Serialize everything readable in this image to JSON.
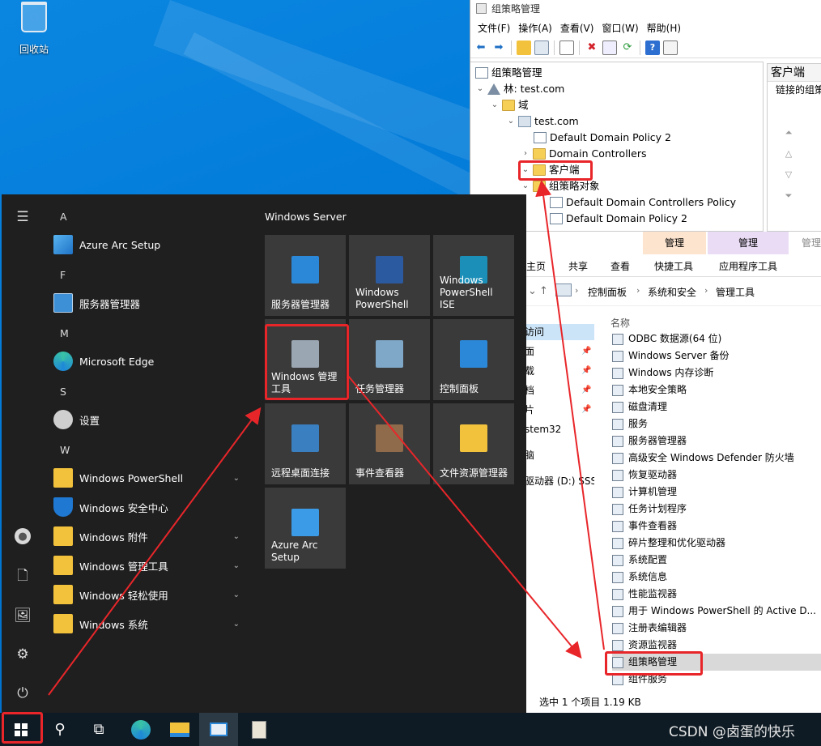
{
  "desktop": {
    "recycle_bin_label": "回收站"
  },
  "gpmc": {
    "title": "组策略管理",
    "menu": [
      "文件(F)",
      "操作(A)",
      "查看(V)",
      "窗口(W)",
      "帮助(H)"
    ],
    "tree": {
      "root": "组策略管理",
      "forest": "林: test.com",
      "domains": "域",
      "domain": "test.com",
      "gpo_link": "Default Domain Policy 2",
      "ou_dc": "Domain Controllers",
      "ou_client": "客户端",
      "gpo_container": "组策略对象",
      "gpo_items": [
        "Default Domain Controllers Policy",
        "Default Domain Policy 2"
      ]
    },
    "right_pane": {
      "header": "客户端",
      "subtitle": "链接的组策"
    }
  },
  "explorer": {
    "context_tabs": [
      "管理",
      "管理",
      "管理"
    ],
    "ribbon_tabs": [
      "主页",
      "共享",
      "查看",
      "快捷工具",
      "应用程序工具"
    ],
    "breadcrumb": [
      "控制面板",
      "系统和安全",
      "管理工具"
    ],
    "column_header": "名称",
    "nav_items": [
      "访问",
      "面",
      "载",
      "档",
      "片",
      "stem32",
      "脑",
      "驱动器 (D:) SSS"
    ],
    "files": [
      "ODBC 数据源(64 位)",
      "Windows Server 备份",
      "Windows 内存诊断",
      "本地安全策略",
      "磁盘清理",
      "服务",
      "服务器管理器",
      "高级安全 Windows Defender 防火墙",
      "恢复驱动器",
      "计算机管理",
      "任务计划程序",
      "事件查看器",
      "碎片整理和优化驱动器",
      "系统配置",
      "系统信息",
      "性能监视器",
      "用于 Windows PowerShell 的 Active D...",
      "注册表编辑器",
      "资源监视器",
      "组策略管理",
      "组件服务"
    ],
    "selected_file": "组策略管理",
    "status": "选中 1 个项目  1.19 KB"
  },
  "start_menu": {
    "sections": [
      {
        "letter": "A",
        "items": [
          {
            "label": "Azure Arc Setup",
            "icon": "azure-arc-icon"
          }
        ]
      },
      {
        "letter": "F",
        "items": [
          {
            "label": "服务器管理器",
            "icon": "server-manager-icon"
          }
        ]
      },
      {
        "letter": "M",
        "items": [
          {
            "label": "Microsoft Edge",
            "icon": "edge-icon"
          }
        ]
      },
      {
        "letter": "S",
        "items": [
          {
            "label": "设置",
            "icon": "gear-icon"
          }
        ]
      },
      {
        "letter": "W",
        "items": [
          {
            "label": "Windows PowerShell",
            "icon": "folder-icon",
            "expandable": true
          },
          {
            "label": "Windows 安全中心",
            "icon": "shield-icon",
            "expandable": false
          },
          {
            "label": "Windows 附件",
            "icon": "folder-icon",
            "expandable": true
          },
          {
            "label": "Windows 管理工具",
            "icon": "folder-icon",
            "expandable": true
          },
          {
            "label": "Windows 轻松使用",
            "icon": "folder-icon",
            "expandable": true
          },
          {
            "label": "Windows 系统",
            "icon": "folder-icon",
            "expandable": true
          }
        ]
      }
    ],
    "tiles_title": "Windows Server",
    "tiles": [
      {
        "label": "服务器管理器",
        "icon": "server-manager-icon",
        "color": "#2b88d8"
      },
      {
        "label": "Windows\nPowerShell",
        "icon": "powershell-icon",
        "color": "#2c5aa0"
      },
      {
        "label": "Windows\nPowerShell ISE",
        "icon": "powershell-ise-icon",
        "color": "#1b8fb8"
      },
      {
        "label": "Windows 管理\n工具",
        "icon": "admin-tools-icon",
        "color": "#9aa6b2"
      },
      {
        "label": "任务管理器",
        "icon": "task-manager-icon",
        "color": "#7fa7c8"
      },
      {
        "label": "控制面板",
        "icon": "control-panel-icon",
        "color": "#2b88d8"
      },
      {
        "label": "远程桌面连接",
        "icon": "remote-desktop-icon",
        "color": "#3a7fc0"
      },
      {
        "label": "事件查看器",
        "icon": "event-viewer-icon",
        "color": "#8f6b4c"
      },
      {
        "label": "文件资源管理器",
        "icon": "file-explorer-icon",
        "color": "#f3c23c"
      },
      {
        "label": "Azure Arc\nSetup",
        "icon": "azure-arc-icon",
        "color": "#3c9be6"
      }
    ]
  },
  "taskbar": {
    "items": [
      "start-icon",
      "search-icon",
      "task-view-icon",
      "edge-icon",
      "file-explorer-icon",
      "control-panel-icon",
      "notepad-icon"
    ]
  },
  "watermark": "CSDN @卤蛋的快乐",
  "colors": {
    "highlight_red": "#e8262a",
    "start_bg": "#1f1f1f",
    "tile_bg": "#3a3a3a",
    "desktop_blue": "#0078d7"
  }
}
